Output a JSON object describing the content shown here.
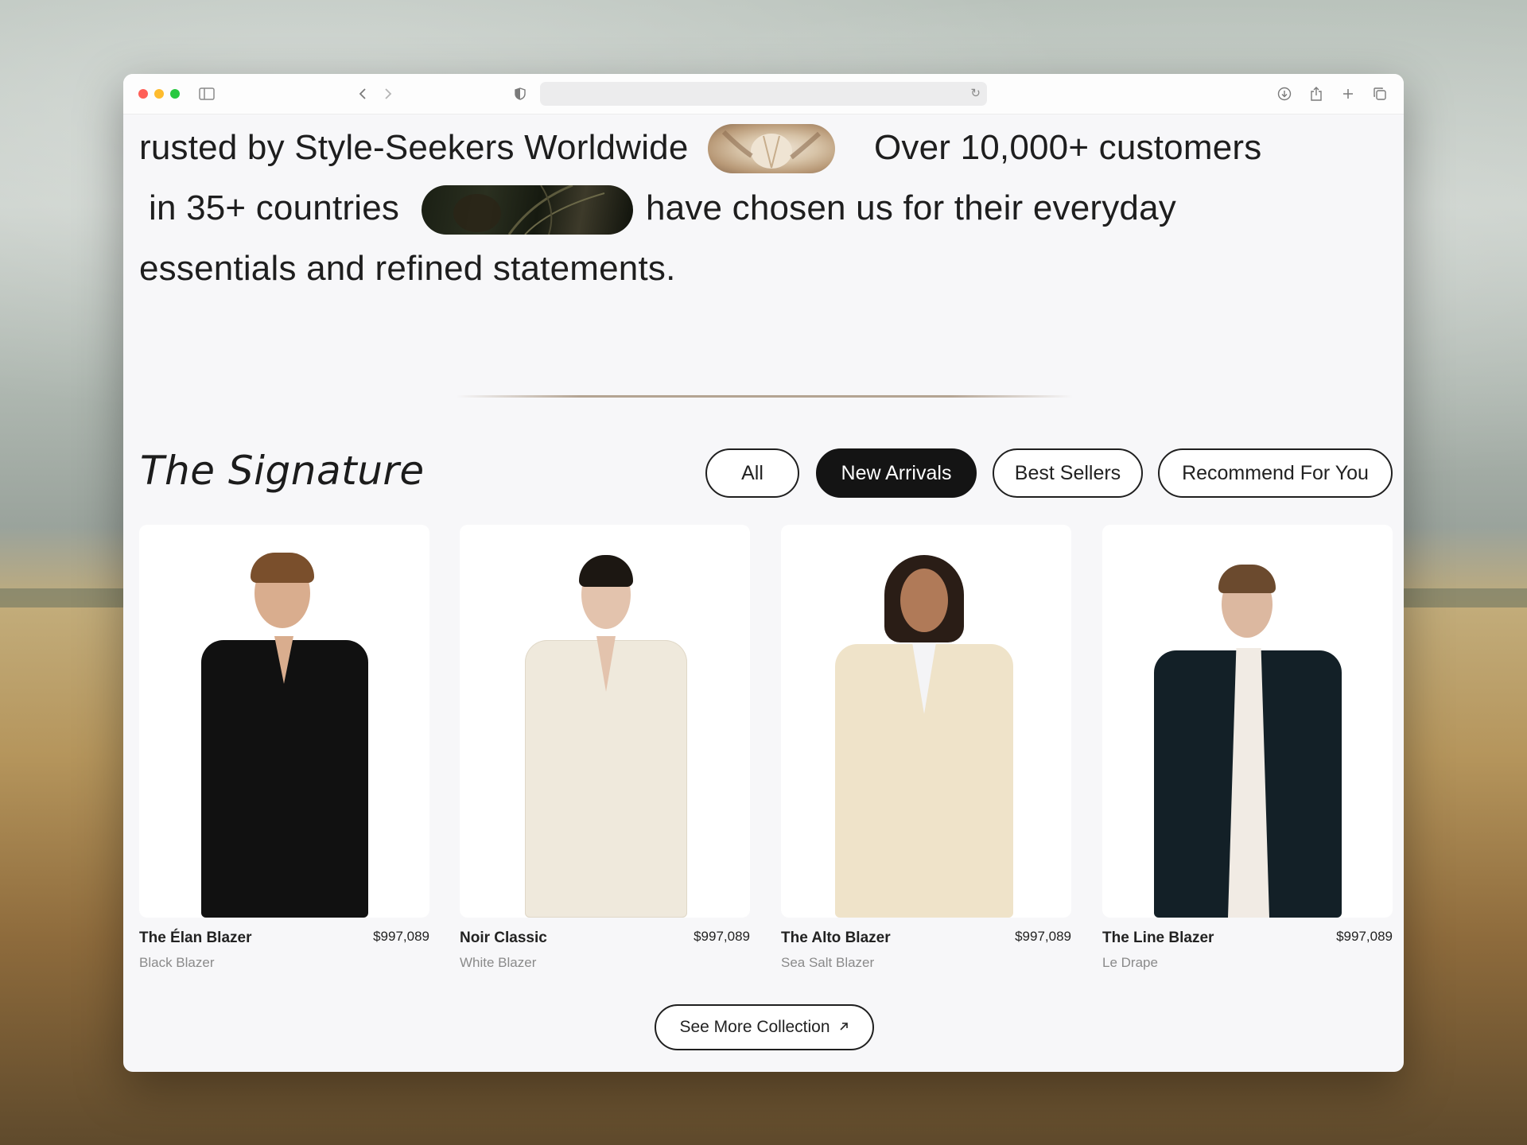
{
  "hero": {
    "line1_part1": "rusted by Style-Seekers Worldwide",
    "line1_part2": "Over 10,000+ customers",
    "line2_part1": "in 35+ countries",
    "line2_part2": "have chosen us for their everyday",
    "line3": "essentials and refined statements."
  },
  "section": {
    "title": "The Signature"
  },
  "filters": [
    {
      "label": "All",
      "active": false
    },
    {
      "label": "New Arrivals",
      "active": true
    },
    {
      "label": "Best Sellers",
      "active": false
    },
    {
      "label": "Recommend For You",
      "active": false
    }
  ],
  "products": [
    {
      "name": "The Élan Blazer",
      "price": "$997,089",
      "subtitle": "Black Blazer",
      "color": "#111111"
    },
    {
      "name": "Noir Classic",
      "price": "$997,089",
      "subtitle": "White Blazer",
      "color": "#efe9dc"
    },
    {
      "name": "The Alto Blazer",
      "price": "$997,089",
      "subtitle": "Sea Salt Blazer",
      "color": "#efe3c9"
    },
    {
      "name": "The Line Blazer",
      "price": "$997,089",
      "subtitle": "Le Drape",
      "color": "#132027"
    }
  ],
  "cta": {
    "label": "See More Collection",
    "icon": "arrow-up-right-icon"
  }
}
